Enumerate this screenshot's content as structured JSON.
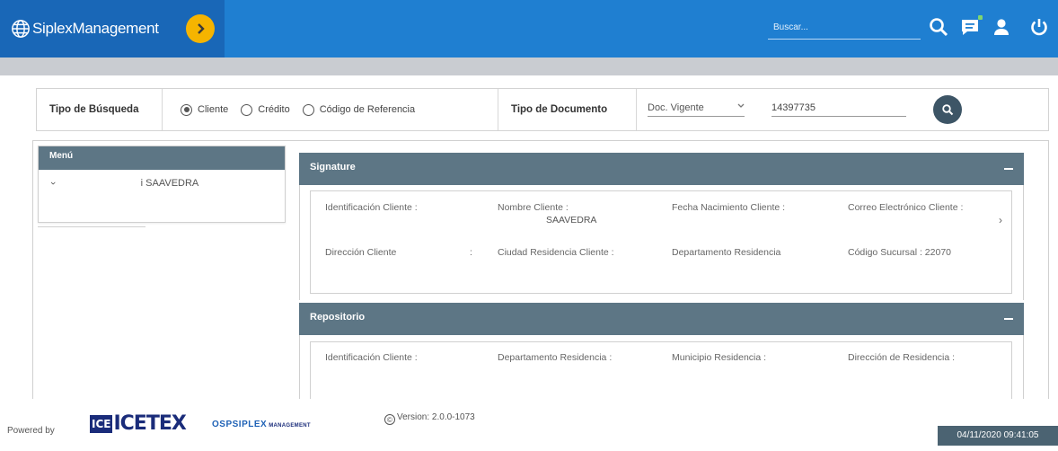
{
  "header": {
    "app_title": "SiplexManagement",
    "search_placeholder": "Buscar...",
    "colors": {
      "bar": "#1f7fd1",
      "brand": "#1967b7",
      "accent": "#f5b400"
    },
    "icons": [
      "globe-icon",
      "chevron-right-icon",
      "search-icon",
      "chat-icon",
      "user-icon",
      "power-icon"
    ]
  },
  "filters": {
    "search_type_label": "Tipo de Búsqueda",
    "options": [
      {
        "label": "Cliente",
        "selected": true
      },
      {
        "label": "Crédito",
        "selected": false
      },
      {
        "label": "Código de Referencia",
        "selected": false
      }
    ],
    "doc_type_label": "Tipo de Documento",
    "doc_type_value": "Doc. Vigente",
    "document_number": "14397735"
  },
  "menu": {
    "title": "Menú",
    "client_name": "i SAAVEDRA"
  },
  "signature": {
    "title": "Signature",
    "fields": {
      "id_label": "Identificación Cliente :",
      "name_label": "Nombre Cliente :",
      "name_value": "SAAVEDRA",
      "birth_label": "Fecha Nacimiento Cliente :",
      "email_label": "Correo Electrónico Cliente :",
      "address_label": "Dirección Cliente",
      "address_sep": ":",
      "city_label": "Ciudad Residencia Cliente :",
      "dept_label": "Departamento Residencia",
      "branch_label": "Código Sucursal : 22070"
    }
  },
  "repository": {
    "title": "Repositorio",
    "fields": {
      "id_label": "Identificación Cliente :",
      "dept_label": "Departamento Residencia :",
      "municipality_label": "Municipio Residencia :",
      "address_label": "Dirección de Residencia :"
    }
  },
  "footer": {
    "powered_by": "Powered by",
    "icetex_box": "ICE",
    "icetex_rest": "ICETEX",
    "osp_brand": "OSPSIPLEX",
    "osp_management": "MANAGEMENT",
    "copyright": "©",
    "version": "Version: 2.0.0-1073",
    "datetime": "04/11/2020 09:41:05"
  }
}
